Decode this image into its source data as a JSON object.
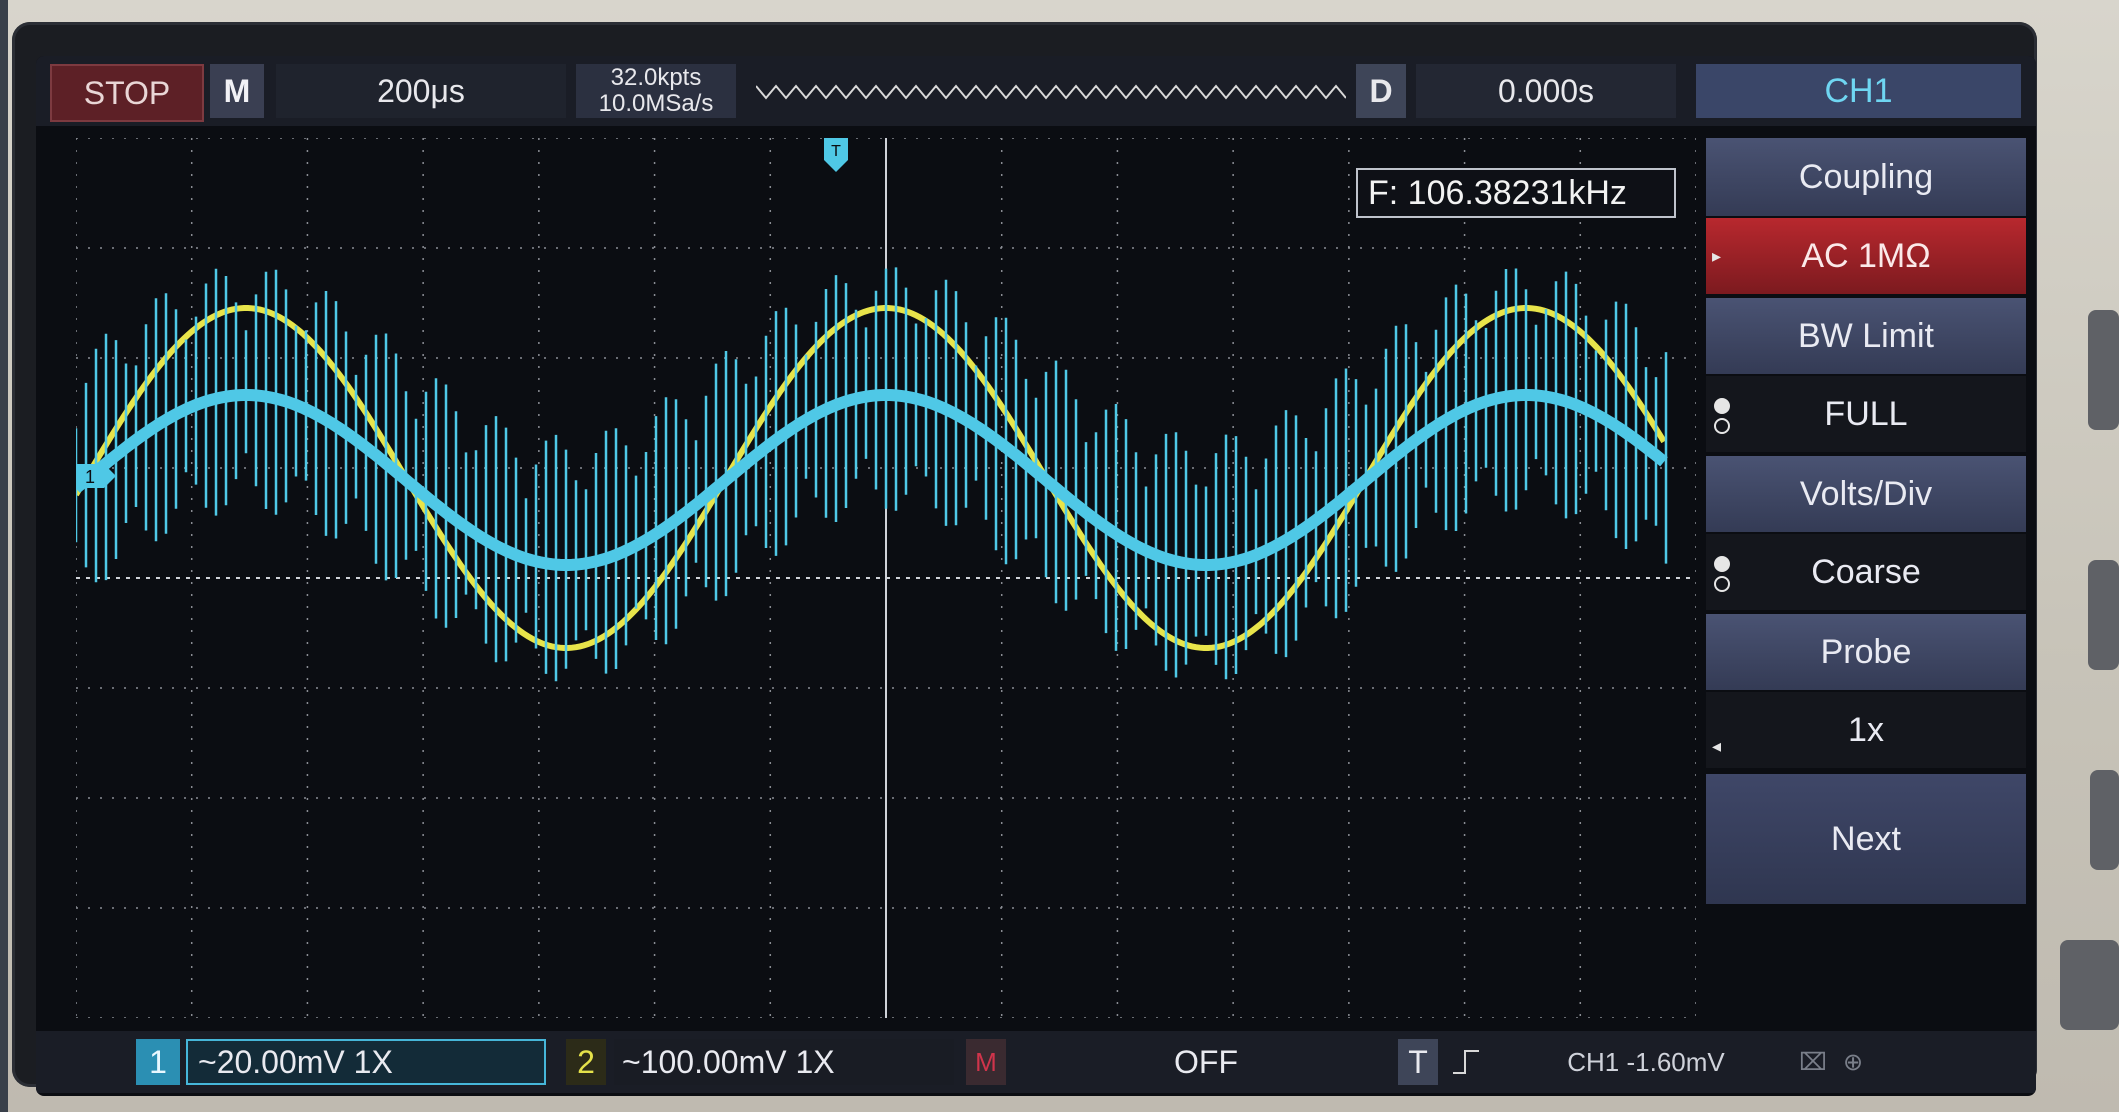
{
  "top_bar": {
    "run_state": "STOP",
    "mode_label": "M",
    "timebase": "200μs",
    "memory_depth": "32.0kpts",
    "sample_rate": "10.0MSa/s",
    "delay_label": "D",
    "delay_value": "0.000s",
    "channel_title": "CH1"
  },
  "grid": {
    "frequency_readout": "F: 106.38231kHz",
    "trigger_marker": "T",
    "ch1_marker": "1"
  },
  "side_menu": {
    "items": [
      {
        "label": "Coupling",
        "style": "title"
      },
      {
        "label": "AC 1MΩ",
        "style": "selected"
      },
      {
        "label": "BW Limit",
        "style": "title"
      },
      {
        "label": "FULL",
        "style": "value"
      },
      {
        "label": "Volts/Div",
        "style": "title"
      },
      {
        "label": "Coarse",
        "style": "value"
      },
      {
        "label": "Probe",
        "style": "title"
      },
      {
        "label": "1x",
        "style": "value"
      },
      {
        "label": "Next",
        "style": "next"
      }
    ]
  },
  "bottom_bar": {
    "ch1_number": "1",
    "ch1_scale": "~20.00mV  1X",
    "ch2_number": "2",
    "ch2_scale": "~100.00mV  1X",
    "math_label": "M",
    "math_state": "OFF",
    "trigger_label": "T",
    "trigger_edge_icon": "rising-edge-icon",
    "trigger_value": "CH1 -1.60mV",
    "usb_icon": "usb-icon"
  },
  "colors": {
    "ch1": "#4fc8e6",
    "ch2": "#e8e44a",
    "stop": "#5d2026",
    "selected_menu": "#b8282e",
    "menu_title": "#3f4768"
  }
}
